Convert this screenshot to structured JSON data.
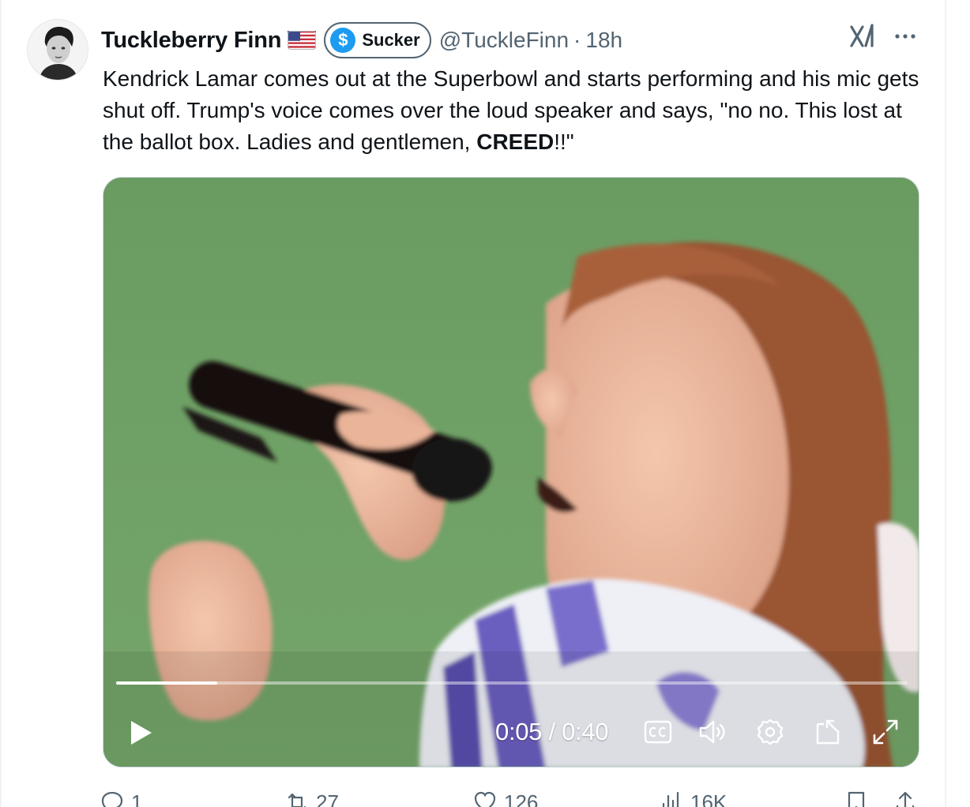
{
  "tweet": {
    "display_name": "Tuckleberry Finn",
    "badge_label": "Sucker",
    "handle": "@TuckleFinn",
    "separator": "·",
    "time": "18h",
    "text_part1": "Kendrick Lamar comes out at the Superbowl and starts performing and his mic gets shut off. Trump's voice comes over the loud speaker and says, \"no no. This lost at the ballot box. Ladies and gentlemen, ",
    "text_bold": "CREED",
    "text_part2": "!!\""
  },
  "video": {
    "time_readout": "0:05 / 0:40",
    "progress": 0.128
  },
  "actions": {
    "replies": "1",
    "reposts": "27",
    "likes": "126",
    "views": "16K"
  },
  "colors": {
    "accent": "#1d9bf0",
    "text": "#0f1419",
    "secondary": "#536471"
  }
}
